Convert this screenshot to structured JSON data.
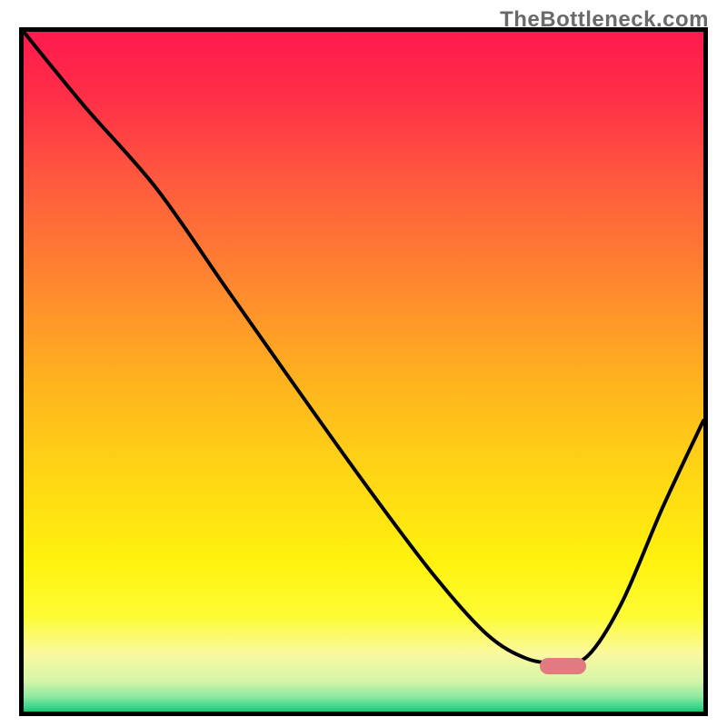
{
  "attribution": "TheBottleneck.com",
  "plot": {
    "inner_w": 748,
    "inner_h": 748
  },
  "gradient_stops": [
    {
      "offset": 0.0,
      "color": "#ff1a4e"
    },
    {
      "offset": 0.1,
      "color": "#ff3047"
    },
    {
      "offset": 0.22,
      "color": "#ff5a3e"
    },
    {
      "offset": 0.38,
      "color": "#ff8a2e"
    },
    {
      "offset": 0.52,
      "color": "#ffb41e"
    },
    {
      "offset": 0.66,
      "color": "#ffd814"
    },
    {
      "offset": 0.78,
      "color": "#fff20e"
    },
    {
      "offset": 0.86,
      "color": "#fdfc34"
    },
    {
      "offset": 0.915,
      "color": "#faf9a0"
    },
    {
      "offset": 0.955,
      "color": "#d6f5a8"
    },
    {
      "offset": 0.978,
      "color": "#8fe9a2"
    },
    {
      "offset": 0.992,
      "color": "#3fd98e"
    },
    {
      "offset": 1.0,
      "color": "#16c96e"
    }
  ],
  "marker": {
    "x_start": 0.76,
    "x_end": 0.828,
    "y": 0.933,
    "color": "#e27b81"
  },
  "chart_data": {
    "type": "line",
    "title": "",
    "xlabel": "",
    "ylabel": "",
    "xlim": [
      0,
      1
    ],
    "ylim": [
      0,
      1
    ],
    "note": "Axes are unlabeled in the source image; x/y are normalized 0–1. y represents the plotted curve height (1 = top of frame, 0 = bottom).",
    "series": [
      {
        "name": "curve",
        "x": [
          0.0,
          0.09,
          0.195,
          0.3,
          0.4,
          0.5,
          0.6,
          0.68,
          0.74,
          0.79,
          0.83,
          0.88,
          0.94,
          1.0
        ],
        "y": [
          1.0,
          0.89,
          0.77,
          0.62,
          0.478,
          0.338,
          0.205,
          0.115,
          0.078,
          0.072,
          0.082,
          0.16,
          0.3,
          0.428
        ]
      }
    ],
    "optimal_marker": {
      "x_start": 0.76,
      "x_end": 0.828,
      "y": 0.067
    }
  }
}
